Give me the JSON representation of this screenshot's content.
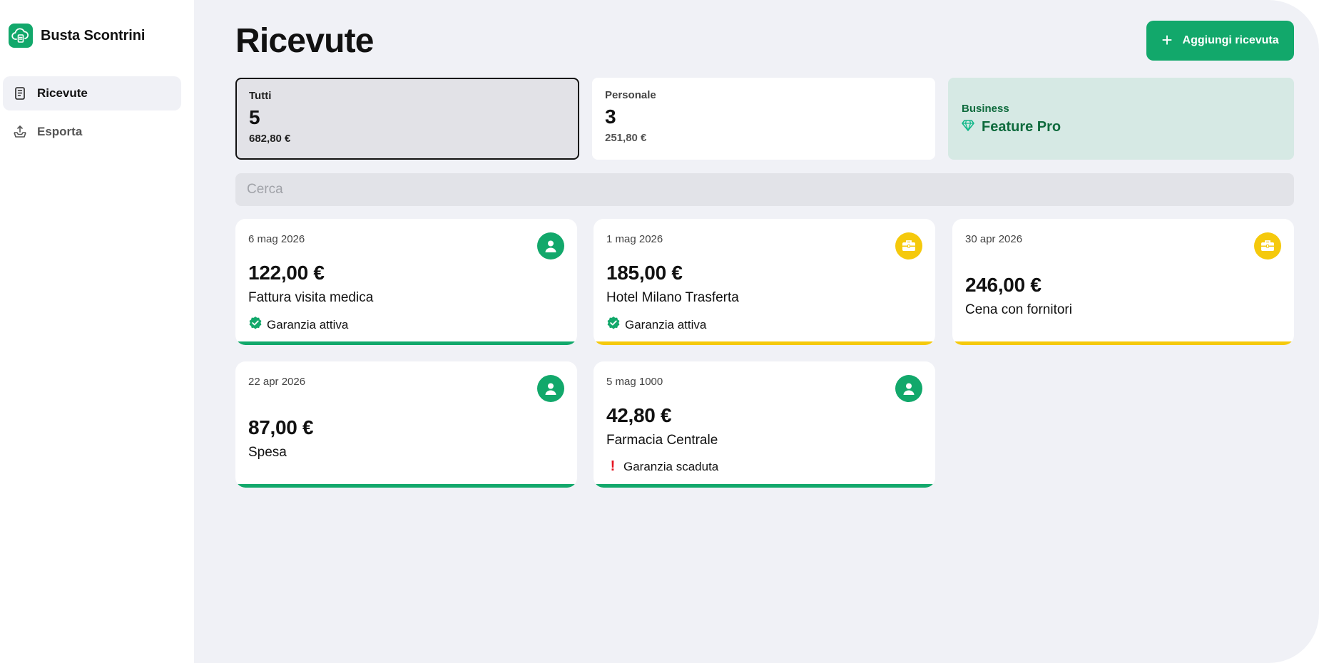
{
  "app": {
    "title": "Busta Scontrini"
  },
  "sidebar": {
    "items": [
      {
        "label": "Ricevute",
        "icon": "receipt-icon",
        "active": true
      },
      {
        "label": "Esporta",
        "icon": "export-icon",
        "active": false
      }
    ]
  },
  "header": {
    "title": "Ricevute",
    "add_label": "Aggiungi ricevuta"
  },
  "summary": {
    "all": {
      "label": "Tutti",
      "count": "5",
      "total": "682,80 €"
    },
    "personal": {
      "label": "Personale",
      "count": "3",
      "total": "251,80 €"
    },
    "business": {
      "label": "Business",
      "pro_label": "Feature Pro"
    }
  },
  "search": {
    "placeholder": "Cerca",
    "value": ""
  },
  "receipts": [
    {
      "date": "6 mag 2026",
      "amount": "122,00 €",
      "name": "Fattura visita medica",
      "type": "personal",
      "warranty": "Garanzia attiva",
      "warranty_status": "active"
    },
    {
      "date": "1 mag 2026",
      "amount": "185,00 €",
      "name": "Hotel Milano Trasferta",
      "type": "business",
      "warranty": "Garanzia attiva",
      "warranty_status": "active"
    },
    {
      "date": "30 apr 2026",
      "amount": "246,00 €",
      "name": "Cena con fornitori",
      "type": "business",
      "warranty": null,
      "warranty_status": "none"
    },
    {
      "date": "22 apr 2026",
      "amount": "87,00 €",
      "name": "Spesa",
      "type": "personal",
      "warranty": null,
      "warranty_status": "none"
    },
    {
      "date": "5 mag 1000",
      "amount": "42,80 €",
      "name": "Farmacia Centrale",
      "type": "personal",
      "warranty": "Garanzia scaduta",
      "warranty_status": "expired"
    }
  ],
  "colors": {
    "accent": "#12a86b",
    "business": "#f5c90c",
    "pro_background": "#d6e9e4",
    "pro_text": "#0f6b3d",
    "expired": "#e5121f",
    "main_background": "#f0f1f6"
  }
}
